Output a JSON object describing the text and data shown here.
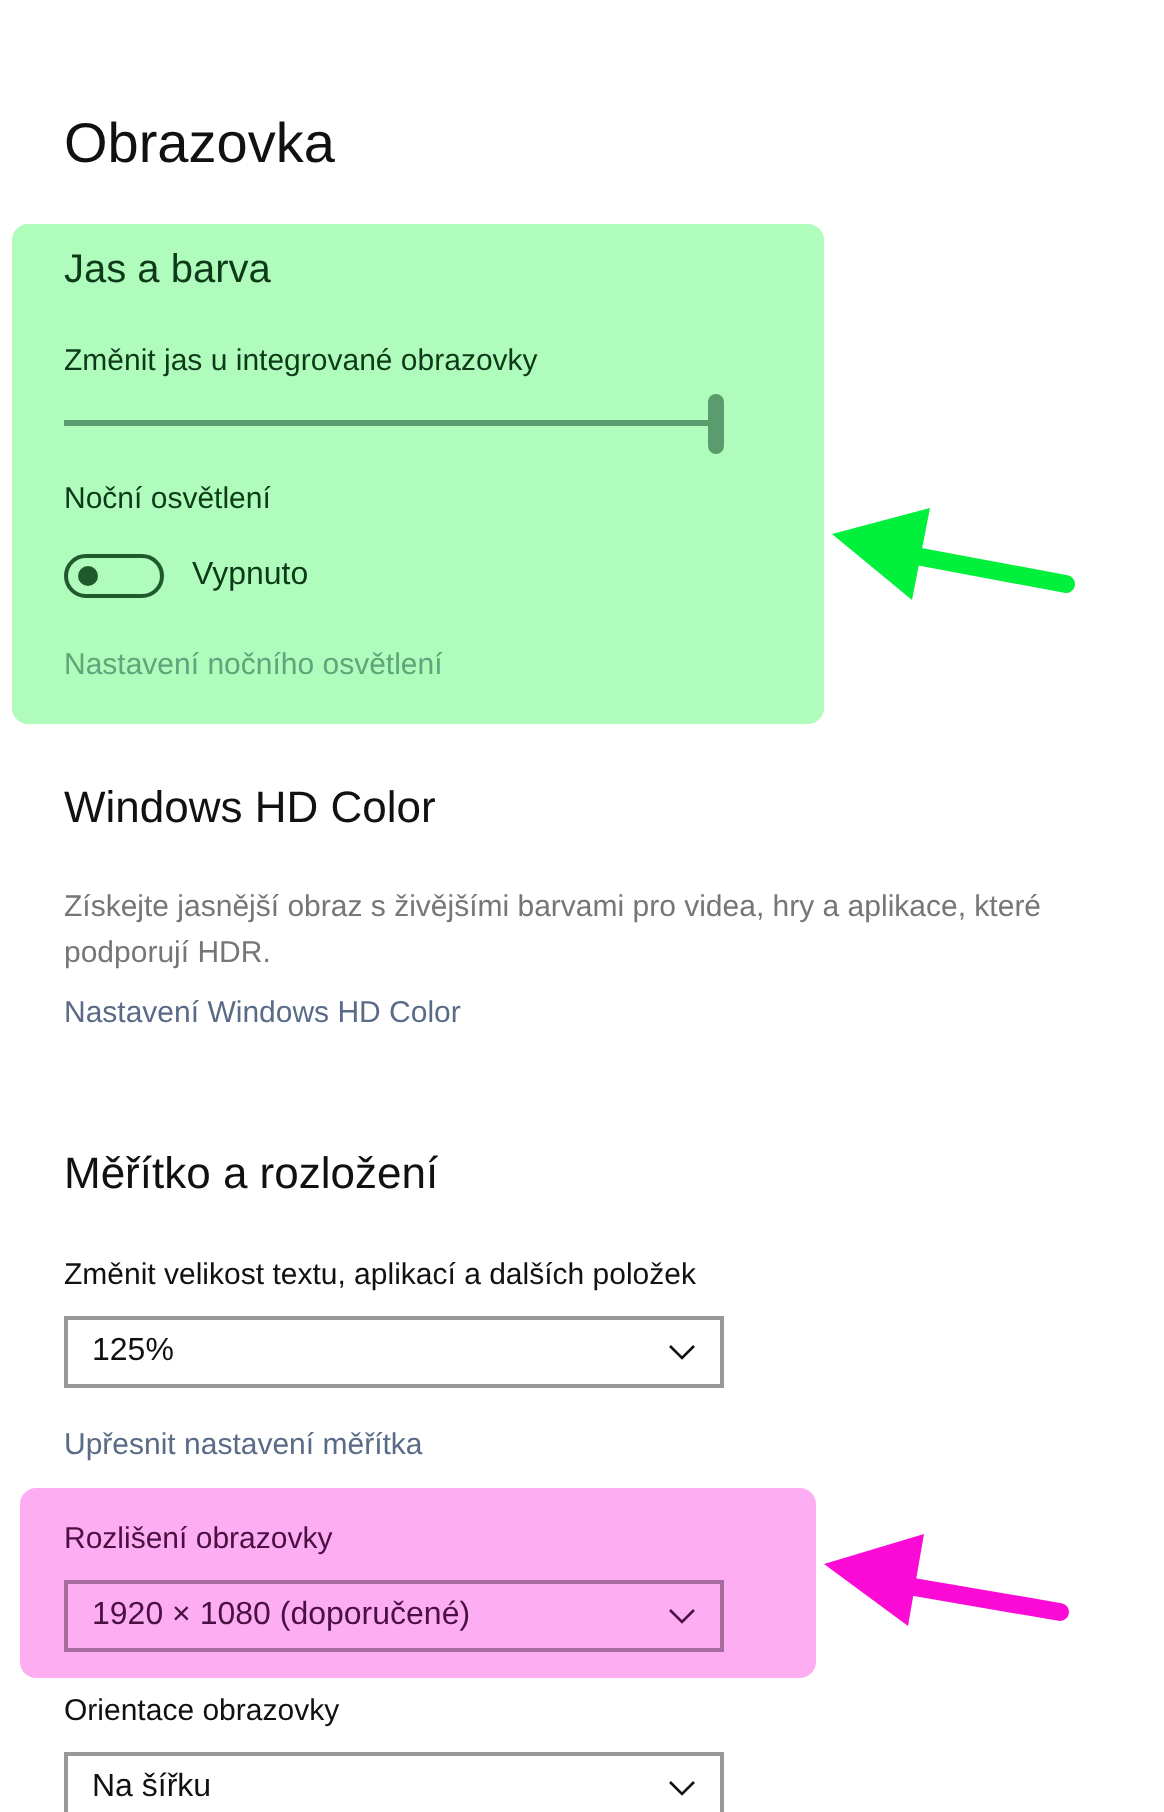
{
  "title": "Obrazovka",
  "brightness": {
    "heading": "Jas a barva",
    "slider_label": "Změnit jas u integrované obrazovky",
    "slider": {
      "level": 1.0
    },
    "night_label": "Noční osvětlení",
    "toggle": {
      "on": false,
      "label": "Vypnuto"
    },
    "link": "Nastavení nočního osvětlení",
    "highlight": {
      "color": "#b0fcbc",
      "arrow": {
        "color": "#00f03c"
      }
    }
  },
  "hd_color": {
    "heading": "Windows HD Color",
    "description": "Získejte jasnější obraz s živějšími barvami pro videa, hry a aplikace, které podporují HDR.",
    "link": "Nastavení Windows HD Color"
  },
  "scale": {
    "heading": "Měřítko a rozložení",
    "size_label": "Změnit velikost textu, aplikací a dalších položek",
    "size_value": "125%",
    "link": "Upřesnit nastavení měřítka",
    "resolution_label": "Rozlišení obrazovky",
    "resolution_value": "1920 × 1080 (doporučené)",
    "resolution_highlight": {
      "color": "#fdaef3",
      "arrow": {
        "color": "#fc0ad6"
      }
    },
    "orientation_label": "Orientace obrazovky",
    "orientation_value": "Na šířku"
  }
}
